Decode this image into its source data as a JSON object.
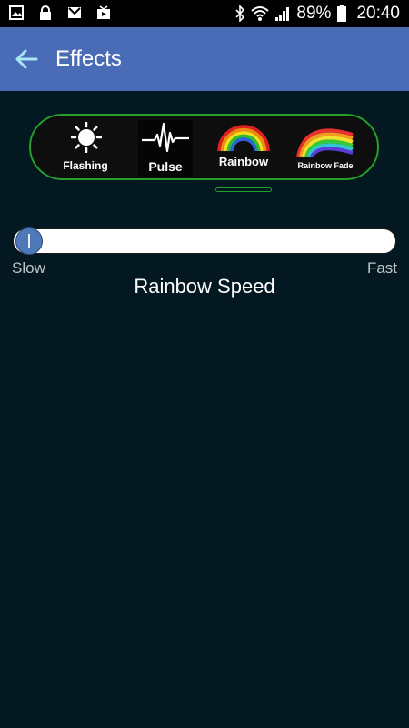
{
  "status_bar": {
    "battery_percent": "89%",
    "time": "20:40",
    "left_icons": [
      "gallery-icon",
      "lock-icon",
      "gmail-icon",
      "video-icon"
    ],
    "right_icons": [
      "bluetooth-icon",
      "wifi-icon",
      "signal-icon",
      "battery-icon"
    ]
  },
  "app_bar": {
    "title": "Effects",
    "back_icon": "arrow-left-icon",
    "color": "#4a6bb6"
  },
  "effects": [
    {
      "label": "Flashing",
      "icon": "sun-icon"
    },
    {
      "label": "Pulse",
      "icon": "pulse-icon"
    },
    {
      "label": "Rainbow",
      "icon": "rainbow-icon"
    },
    {
      "label": "Rainbow Fade",
      "icon": "rainbow-fade-icon"
    }
  ],
  "selected_effect": "Rainbow",
  "slider": {
    "title": "Rainbow Speed",
    "min_label": "Slow",
    "max_label": "Fast",
    "value": 0.0
  },
  "colors": {
    "background": "#031820",
    "accent_green": "#22a02a",
    "thumb": "#4f78b8"
  }
}
